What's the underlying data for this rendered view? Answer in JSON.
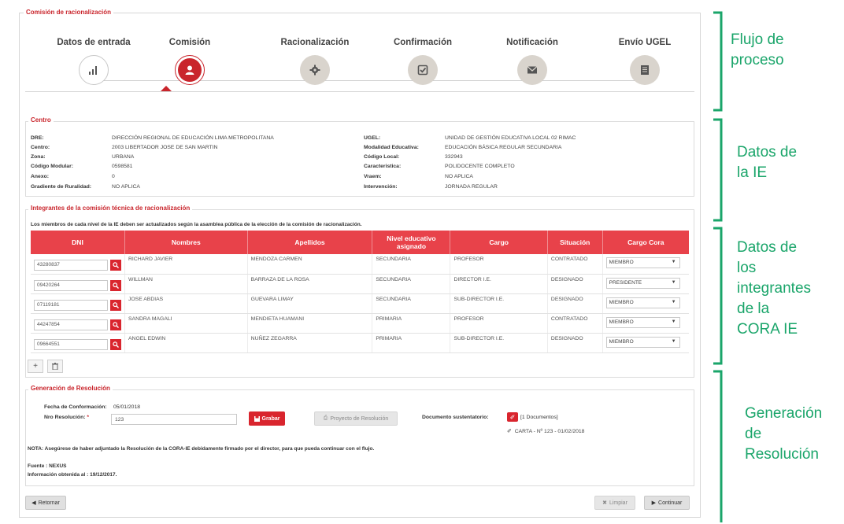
{
  "panel_title": "Comisión de racionalización",
  "steps": [
    {
      "label": "Datos de entrada",
      "icon": "bar-chart-icon",
      "state": "done"
    },
    {
      "label": "Comisión",
      "icon": "user-icon",
      "state": "active"
    },
    {
      "label": "Racionalización",
      "icon": "gear-icon",
      "state": "pending"
    },
    {
      "label": "Confirmación",
      "icon": "check-icon",
      "state": "pending"
    },
    {
      "label": "Notificación",
      "icon": "envelope-icon",
      "state": "pending"
    },
    {
      "label": "Envío UGEL",
      "icon": "document-icon",
      "state": "pending"
    }
  ],
  "centro": {
    "title": "Centro",
    "left": [
      {
        "k": "DRE:",
        "v": "DIRECCIÓN REGIONAL DE EDUCACIÓN LIMA METROPOLITANA"
      },
      {
        "k": "Centro:",
        "v": "2003 LIBERTADOR JOSE DE SAN MARTIN"
      },
      {
        "k": "Zona:",
        "v": "URBANA"
      },
      {
        "k": "Código Modular:",
        "v": "0598581"
      },
      {
        "k": "Anexo:",
        "v": "0"
      },
      {
        "k": "Gradiente de Ruralidad:",
        "v": "NO APLICA"
      }
    ],
    "right": [
      {
        "k": "UGEL:",
        "v": "UNIDAD DE GESTIÓN EDUCATIVA LOCAL 02 RIMAC"
      },
      {
        "k": "Modalidad Educativa:",
        "v": "EDUCACIÓN BÁSICA REGULAR SECUNDARIA"
      },
      {
        "k": "Código Local:",
        "v": "332943"
      },
      {
        "k": "Caracteristica:",
        "v": "POLIDOCENTE COMPLETO"
      },
      {
        "k": "Vraem:",
        "v": "NO APLICA"
      },
      {
        "k": "Intervención:",
        "v": "JORNADA REGULAR"
      }
    ]
  },
  "integrantes": {
    "title": "Integrantes de la comisión técnica de racionalización",
    "note": "Los miembros de cada nivel de la IE deben ser actualizados según la asamblea pública de la elección de la comisión de racionalización.",
    "headers": [
      "DNI",
      "Nombres",
      "Apellidos",
      "Nivel educativo asignado",
      "Cargo",
      "Situación",
      "Cargo Cora"
    ],
    "rows": [
      {
        "dni": "43280837",
        "nombres": "RICHARD JAVIER",
        "apellidos": "MENDOZA CARMEN",
        "nivel": "SECUNDARIA",
        "cargo": "PROFESOR",
        "situacion": "CONTRATADO",
        "cora": "MIEMBRO"
      },
      {
        "dni": "09420264",
        "nombres": "WILLMAN",
        "apellidos": "BARRAZA DE LA ROSA",
        "nivel": "SECUNDARIA",
        "cargo": "DIRECTOR I.E.",
        "situacion": "DESIGNADO",
        "cora": "PRESIDENTE"
      },
      {
        "dni": "07119181",
        "nombres": "JOSE ABDIAS",
        "apellidos": "GUEVARA LIMAY",
        "nivel": "SECUNDARIA",
        "cargo": "SUB-DIRECTOR I.E.",
        "situacion": "DESIGNADO",
        "cora": "MIEMBRO"
      },
      {
        "dni": "44247854",
        "nombres": "SANDRA MAGALI",
        "apellidos": "MENDIETA HUAMANI",
        "nivel": "PRIMARIA",
        "cargo": "PROFESOR",
        "situacion": "CONTRATADO",
        "cora": "MIEMBRO"
      },
      {
        "dni": "09664551",
        "nombres": "ANGEL EDWIN",
        "apellidos": "NUÑEZ ZEGARRA",
        "nivel": "PRIMARIA",
        "cargo": "SUB-DIRECTOR I.E.",
        "situacion": "DESIGNADO",
        "cora": "MIEMBRO"
      }
    ]
  },
  "resolucion": {
    "title": "Generación de Resolución",
    "fecha_label": "Fecha de Conformación:",
    "fecha_value": "05/01/2018",
    "nro_label": "Nro Resolución:",
    "required_mark": "*",
    "nro_value": "123",
    "grabar": "Grabar",
    "proyecto": "Proyecto de Resolución",
    "doc_label": "Documento sustentatorio:",
    "doc_count": "[1 Documentos]",
    "doc_file": "CARTA - Nº 123 - 01/02/2018",
    "nota": "NOTA: Asegúrese de haber adjuntado la Resolución de la CORA-IE debidamente firmado por el director, para que pueda continuar con el flujo.",
    "fuente": "Fuente : NEXUS",
    "info": "Información obtenida al : 19/12/2017."
  },
  "footer": {
    "retornar": "Retornar",
    "limpiar": "Limpiar",
    "continuar": "Continuar"
  },
  "annotations": {
    "flujo": [
      "Flujo de",
      "proceso"
    ],
    "datos_ie": [
      "Datos de",
      "la IE"
    ],
    "datos_integrantes": [
      "Datos de",
      "los",
      "integrantes",
      "de la",
      "CORA IE"
    ],
    "generacion": [
      "Generación",
      "de",
      "Resolución"
    ]
  },
  "colors": {
    "accent": "#c9252c",
    "header": "#e8424a",
    "annotation": "#1aa56a"
  }
}
